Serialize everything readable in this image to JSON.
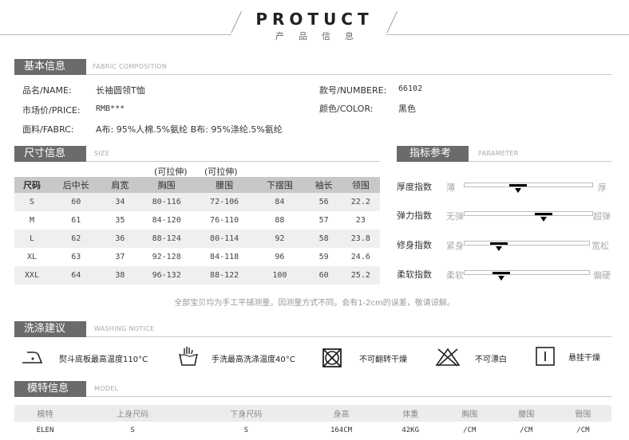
{
  "header": {
    "title": "PROTUCT",
    "subtitle": "产品信息"
  },
  "basic": {
    "title": "基本信息",
    "en": "FABRIC COMPOSITION",
    "name_label": "品名/NAME:",
    "name_value": "长袖圆领T恤",
    "price_label": "市场价/PRICE:",
    "price_value": "RMB***",
    "fabric_label": "面料/FABRC:",
    "fabric_value": "A布: 95%人棉.5%氨纶  B布: 95%涤纶.5%氨纶",
    "number_label": "款号/NUMBERE:",
    "number_value": "66102",
    "color_label": "颜色/COLOR:",
    "color_value": "黑色"
  },
  "size": {
    "title": "尺寸信息",
    "en": "SIZE",
    "stretch1": "(可拉伸)",
    "stretch2": "(可拉伸)",
    "headers": [
      "尺码",
      "后中长",
      "肩宽",
      "胸围",
      "腰围",
      "下摆围",
      "袖长",
      "领围"
    ],
    "rows": [
      [
        "S",
        "60",
        "34",
        "80-116",
        "72-106",
        "84",
        "56",
        "22.2"
      ],
      [
        "M",
        "61",
        "35",
        "84-120",
        "76-110",
        "88",
        "57",
        "23"
      ],
      [
        "L",
        "62",
        "36",
        "88-124",
        "80-114",
        "92",
        "58",
        "23.8"
      ],
      [
        "XL",
        "63",
        "37",
        "92-128",
        "84-118",
        "96",
        "59",
        "24.6"
      ],
      [
        "XXL",
        "64",
        "38",
        "96-132",
        "88-122",
        "100",
        "60",
        "25.2"
      ]
    ],
    "note": "全部宝贝均为手工平铺测量，因测量方式不同，会有1-2cm的误差，敬请谅解。"
  },
  "indicators": {
    "title": "指标参考",
    "en": "PARAMETER",
    "items": [
      {
        "label": "厚度指数",
        "low": "薄",
        "high": "厚",
        "level": 0.42
      },
      {
        "label": "弹力指数",
        "low": "无弹",
        "high": "超弹",
        "level": 0.62
      },
      {
        "label": "修身指数",
        "low": "紧身",
        "high": "宽松",
        "level": 0.28
      },
      {
        "label": "柔软指数",
        "low": "柔软",
        "high": "偏硬",
        "level": 0.3
      }
    ]
  },
  "washing": {
    "title": "洗涤建议",
    "en": "WASHING NOTICE",
    "items": [
      {
        "icon": "iron-icon",
        "text": "熨斗底板最高温度110°C"
      },
      {
        "icon": "hand-wash-icon",
        "text": "手洗最高洗涤温度40°C"
      },
      {
        "icon": "no-tumble-dry-icon",
        "text": "不可翻转干燥"
      },
      {
        "icon": "no-bleach-icon",
        "text": "不可漂白"
      },
      {
        "icon": "hang-dry-icon",
        "text": "悬挂干燥"
      }
    ]
  },
  "model": {
    "title": "模特信息",
    "en": "MODEL",
    "headers": [
      "模特",
      "上身尺码",
      "下身尺码",
      "身高",
      "体重",
      "胸围",
      "腰围",
      "臀围"
    ],
    "row": [
      "ELEN",
      "S",
      "S",
      "164CM",
      "42KG",
      "/CM",
      "/CM",
      "/CM"
    ]
  }
}
